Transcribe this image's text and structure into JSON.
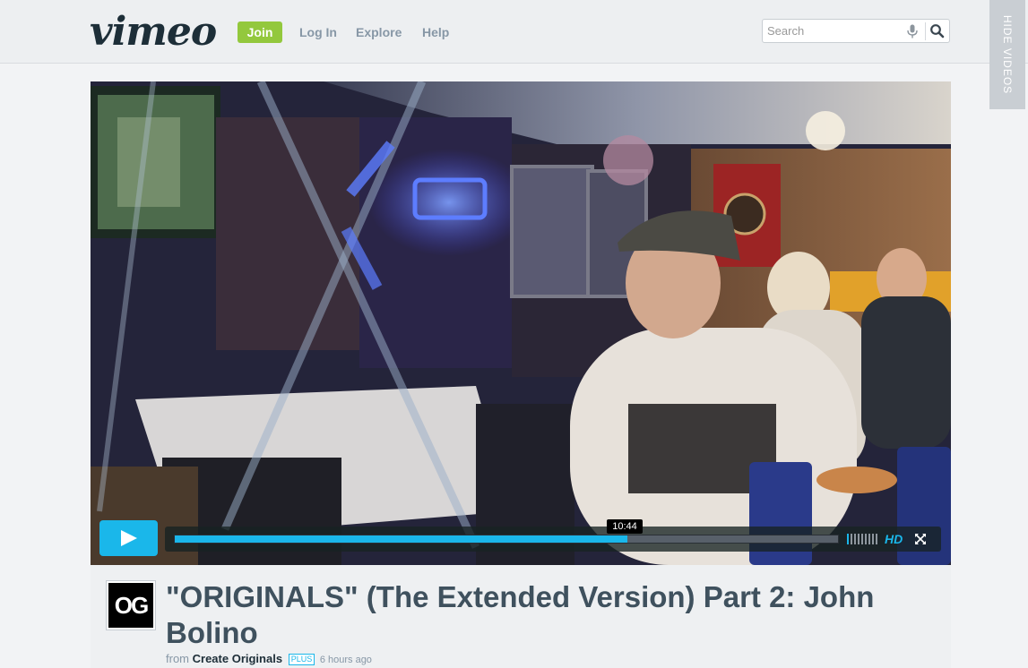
{
  "header": {
    "logo": "vimeo",
    "join_label": "Join",
    "nav": [
      "Log In",
      "Explore",
      "Help"
    ],
    "search_placeholder": "Search",
    "hide_videos_label": "HIDE VIDEOS"
  },
  "player": {
    "current_time": "10:44",
    "progress": 0.683,
    "hd_label": "HD"
  },
  "video": {
    "avatar_text": "OG",
    "title": "\"ORIGINALS\" (The Extended Version) Part 2: John Bolino",
    "from_prefix": "from",
    "author": "Create Originals",
    "badge": "PLUS",
    "posted": "6 hours ago"
  },
  "colors": {
    "accent": "#1ab7ea",
    "join_green": "#93c83d",
    "title": "#3f515e"
  },
  "icons": [
    "microphone-icon",
    "search-icon",
    "play-icon",
    "volume-icon",
    "fullscreen-icon"
  ]
}
